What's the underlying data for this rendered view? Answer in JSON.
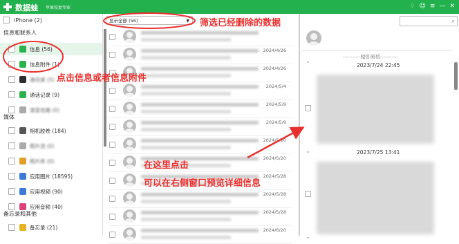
{
  "titlebar": {
    "app_name": "数据蛙",
    "subtitle": "苹果恢复专家",
    "icons": [
      "shirt-icon",
      "chat-icon",
      "menu-icon",
      "minimize-icon",
      "close-icon"
    ]
  },
  "sidebar": {
    "device": "iPhone (2)",
    "section_messages": "信息和联系人",
    "items_messages": [
      {
        "label": "信息 (56)",
        "icon_color": "#2bb24c",
        "blur": false
      },
      {
        "label": "信息附件 (1)",
        "icon_color": "#2bb24c",
        "blur": false
      },
      {
        "label": "通讯录 (5)",
        "icon_color": "#2d2d2d",
        "blur": true
      },
      {
        "label": "通话记录 (9)",
        "icon_color": "#2bb24c",
        "blur": false
      },
      {
        "label": "语音信箱 (0)",
        "icon_color": "#aaaaaa",
        "blur": true
      }
    ],
    "section_media": "媒体",
    "items_media": [
      {
        "label": "相机胶卷 (184)",
        "icon_color": "#555555",
        "blur": false
      },
      {
        "label": "照片流 (0)",
        "icon_color": "#aaaaaa",
        "blur": true
      },
      {
        "label": "照片库 (0)",
        "icon_color": "#e0a02a",
        "blur": true
      },
      {
        "label": "应用图片 (18595)",
        "icon_color": "#3a7bd5",
        "blur": false
      },
      {
        "label": "应用视频 (90)",
        "icon_color": "#3a7bd5",
        "blur": false
      },
      {
        "label": "应用音频 (40)",
        "icon_color": "#e0407a",
        "blur": false
      }
    ],
    "section_memo": "备忘录和其他",
    "items_memo": [
      {
        "label": "备忘录 (21)",
        "icon_color": "#e6b422",
        "blur": false
      }
    ]
  },
  "middle": {
    "filter_value": "显示全部 (56)",
    "rows": [
      {
        "date": ""
      },
      {
        "date": "2024/4/26"
      },
      {
        "date": "2024/4/26"
      },
      {
        "date": "2024/5/4"
      },
      {
        "date": "2024/5/9"
      },
      {
        "date": "2024/5/9"
      },
      {
        "date": "2024/5/20"
      },
      {
        "date": "2024/5/20"
      },
      {
        "date": "2024/5/28"
      },
      {
        "date": "2024/5/28"
      },
      {
        "date": "2024/5/28"
      },
      {
        "date": "2024/6/20"
      }
    ]
  },
  "right": {
    "caption": "-----------短信/彩信-----------",
    "date1": "2023/7/24 22:45",
    "date2": "2023/7/25 13:41"
  },
  "annotations": {
    "filter_hint": "筛选已经删除的数据",
    "click_hint": "点击信息或者信息附件",
    "preview_hint_1": "在这里点击",
    "preview_hint_2": "可以在右侧窗口预览详细信息",
    "accent_color": "#e8312f"
  }
}
